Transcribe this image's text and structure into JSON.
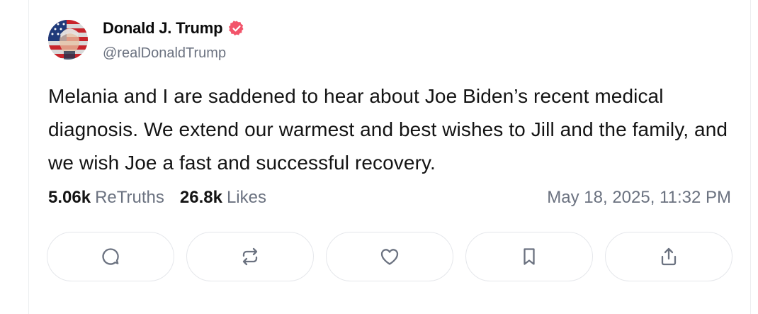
{
  "author": {
    "name": "Donald J. Trump",
    "handle": "@realDonaldTrump",
    "avatar_icon": "avatar-american-flag-portrait",
    "verified_icon": "verified-badge-icon",
    "verified_color": "#f2546a"
  },
  "post": {
    "text": "Melania and I are saddened to hear about Joe Biden’s recent medical diagnosis. We extend our warmest and best wishes to Jill and the family, and we wish Joe a fast and successful recovery."
  },
  "stats": {
    "retruths_count": "5.06k",
    "retruths_label": "ReTruths",
    "likes_count": "26.8k",
    "likes_label": "Likes"
  },
  "timestamp": "May 18, 2025, 11:32 PM",
  "actions": [
    {
      "icon": "reply-icon"
    },
    {
      "icon": "retruth-icon"
    },
    {
      "icon": "like-heart-icon"
    },
    {
      "icon": "bookmark-icon"
    },
    {
      "icon": "share-icon"
    }
  ]
}
